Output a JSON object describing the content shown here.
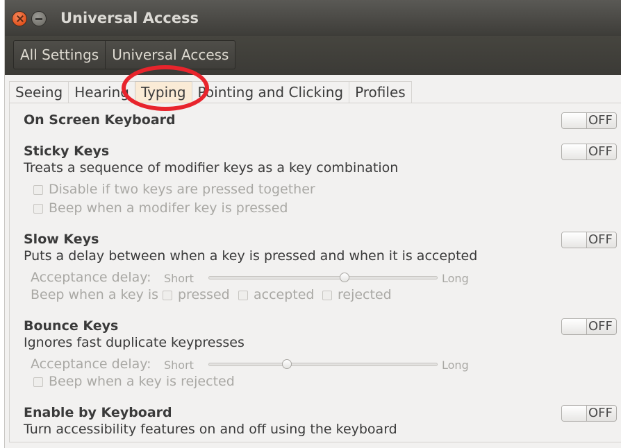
{
  "window": {
    "title": "Universal Access",
    "close_icon": "close-icon",
    "minimize_icon": "minimize-icon"
  },
  "breadcrumb": {
    "items": [
      "All Settings",
      "Universal Access"
    ]
  },
  "tabs": [
    {
      "label": "Seeing",
      "active": false
    },
    {
      "label": "Hearing",
      "active": false
    },
    {
      "label": "Typing",
      "active": true
    },
    {
      "label": "Pointing and Clicking",
      "active": false
    },
    {
      "label": "Profiles",
      "active": false
    }
  ],
  "annotation": {
    "color": "#e8242c",
    "target": "Typing"
  },
  "sections": {
    "on_screen_keyboard": {
      "title": "On Screen Keyboard",
      "toggle": "OFF"
    },
    "sticky_keys": {
      "title": "Sticky Keys",
      "toggle": "OFF",
      "description": "Treats a sequence of modifier keys as a key combination",
      "options": [
        "Disable if two keys are pressed together",
        "Beep when a modifer key is pressed"
      ]
    },
    "slow_keys": {
      "title": "Slow Keys",
      "toggle": "OFF",
      "description": "Puts a delay between when a key is pressed and when it is accepted",
      "delay_label": "Acceptance delay:",
      "short_label": "Short",
      "long_label": "Long",
      "delay_level": 0.59,
      "beep_label": "Beep when a key is",
      "beep_options": [
        "pressed",
        "accepted",
        "rejected"
      ]
    },
    "bounce_keys": {
      "title": "Bounce Keys",
      "toggle": "OFF",
      "description": "Ignores fast duplicate keypresses",
      "delay_label": "Acceptance delay:",
      "short_label": "Short",
      "long_label": "Long",
      "delay_level": 0.34,
      "option": "Beep when a key is rejected"
    },
    "enable_by_keyboard": {
      "title": "Enable by Keyboard",
      "toggle": "OFF",
      "description": "Turn accessibility features on and off using the keyboard"
    }
  }
}
